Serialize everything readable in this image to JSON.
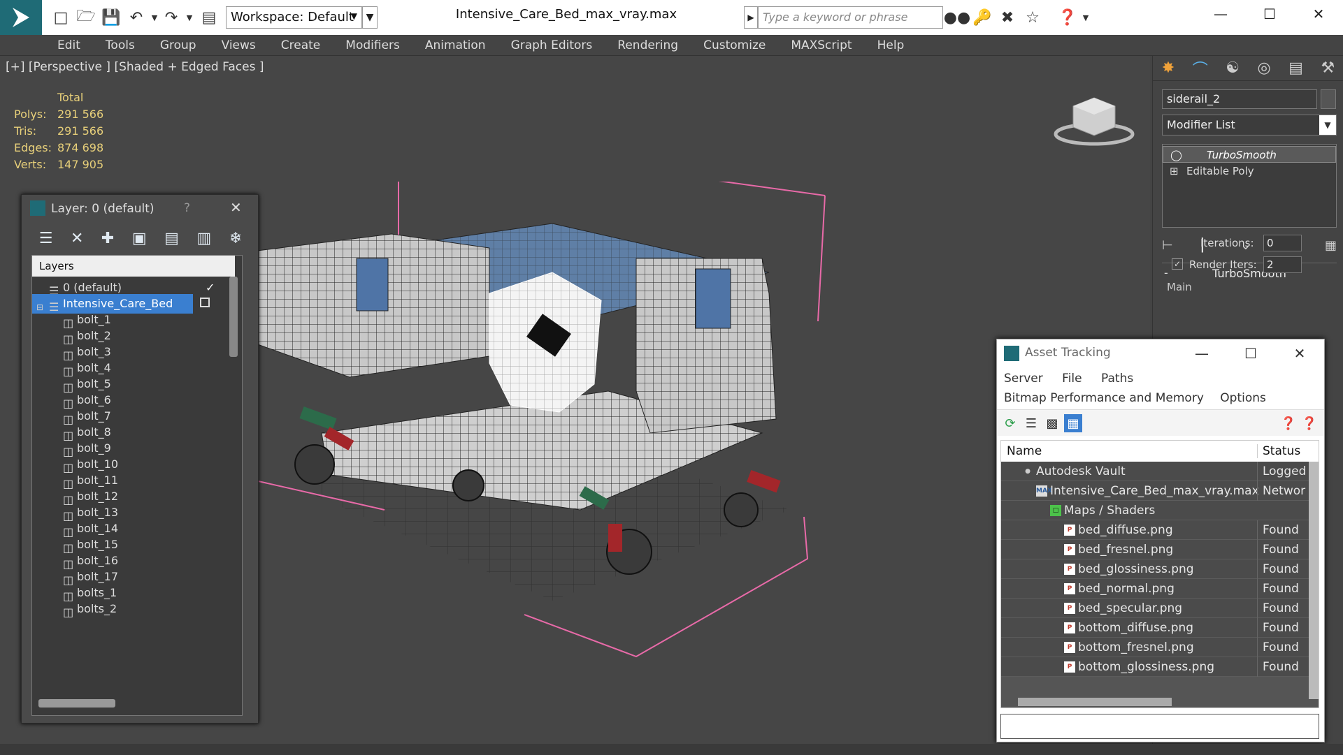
{
  "titlebar": {
    "workspace": "Workspace: Default",
    "filename": "Intensive_Care_Bed_max_vray.max",
    "search_placeholder": "Type a keyword or phrase"
  },
  "menu": [
    "Edit",
    "Tools",
    "Group",
    "Views",
    "Create",
    "Modifiers",
    "Animation",
    "Graph Editors",
    "Rendering",
    "Customize",
    "MAXScript",
    "Help"
  ],
  "viewport": {
    "label": "[+] [Perspective ] [Shaded + Edged Faces ]",
    "stats": {
      "header": "Total",
      "rows": [
        {
          "label": "Polys:",
          "value": "291 566"
        },
        {
          "label": "Tris:",
          "value": "291 566"
        },
        {
          "label": "Edges:",
          "value": "874 698"
        },
        {
          "label": "Verts:",
          "value": "147 905"
        }
      ]
    }
  },
  "layer_panel": {
    "title": "Layer: 0 (default)",
    "help": "?",
    "header": "Layers",
    "rows": [
      "0 (default)",
      "Intensive_Care_Bed",
      "bolt_1",
      "bolt_2",
      "bolt_3",
      "bolt_4",
      "bolt_5",
      "bolt_6",
      "bolt_7",
      "bolt_8",
      "bolt_9",
      "bolt_10",
      "bolt_11",
      "bolt_12",
      "bolt_13",
      "bolt_14",
      "bolt_15",
      "bolt_16",
      "bolt_17",
      "bolts_1",
      "bolts_2"
    ]
  },
  "command_panel": {
    "object_name": "siderail_2",
    "modifier_list": "Modifier List",
    "stack": [
      "TurboSmooth",
      "Editable Poly"
    ],
    "rollout": "TurboSmooth",
    "group": "Main",
    "iterations_label": "Iterations:",
    "iterations": "0",
    "render_iters_label": "Render Iters:",
    "render_iters": "2"
  },
  "asset_tracking": {
    "title": "Asset Tracking",
    "menu1": [
      "Server",
      "File",
      "Paths"
    ],
    "menu2": [
      "Bitmap Performance and Memory",
      "Options"
    ],
    "col_name": "Name",
    "col_status": "Status",
    "rows": [
      {
        "name": "Autodesk Vault",
        "status": "Logged"
      },
      {
        "name": "Intensive_Care_Bed_max_vray.max",
        "status": "Networ"
      },
      {
        "name": "Maps / Shaders",
        "status": ""
      },
      {
        "name": "bed_diffuse.png",
        "status": "Found"
      },
      {
        "name": "bed_fresnel.png",
        "status": "Found"
      },
      {
        "name": "bed_glossiness.png",
        "status": "Found"
      },
      {
        "name": "bed_normal.png",
        "status": "Found"
      },
      {
        "name": "bed_specular.png",
        "status": "Found"
      },
      {
        "name": "bottom_diffuse.png",
        "status": "Found"
      },
      {
        "name": "bottom_fresnel.png",
        "status": "Found"
      },
      {
        "name": "bottom_glossiness.png",
        "status": "Found"
      }
    ]
  }
}
